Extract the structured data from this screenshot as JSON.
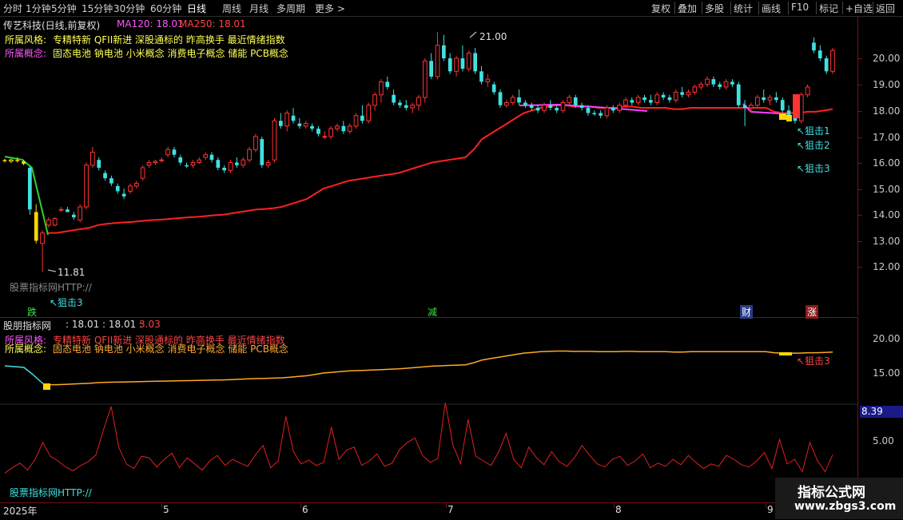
{
  "toolbar": {
    "left": [
      "分时",
      "1分钟",
      "5分钟",
      "15分钟",
      "30分钟",
      "60分钟",
      "日线",
      "周线",
      "月线",
      "多周期",
      "更多 >"
    ],
    "active_index": 6,
    "right": [
      "复权",
      "叠加",
      "多股",
      "统计",
      "画线",
      "F10",
      "标记",
      "+自选",
      "返回"
    ]
  },
  "main": {
    "title": "传艺科技(日线,前复权)",
    "ma120_label": "MA120: 18.01",
    "ma250_label": "MA250: 18.01",
    "style_label": "所属风格:",
    "style_text": "专精特新 QFII新进 深股通标的 昨高换手 最近情绪指数",
    "concept_label": "所属概念:",
    "concept_text": "固态电池 钠电池 小米概念 消费电子概念 储能 PCB概念",
    "high_label": "21.00",
    "low_label": "11.81",
    "watermark": "股票指标网HTTP://",
    "snipe1": "↖狙击1",
    "snipe2": "↖狙击2",
    "snipe3": "↖狙击3",
    "snipe_left": "↖狙击3",
    "marker_die": "跌",
    "marker_jian": "减",
    "marker_cai": "财",
    "marker_zhang": "涨",
    "y_ticks": [
      "20.00",
      "19.00",
      "18.00",
      "17.00",
      "16.00",
      "15.00",
      "14.00",
      "13.00",
      "12.00"
    ]
  },
  "sub": {
    "title": "股朋指标网",
    "values": ": 18.01 : 18.01 :",
    "value3": "3.03",
    "style_label": "所属风格:",
    "style_text": "专精特新 QFII新进 深股通标的 昨高换手 最近情绪指数",
    "concept_label": "所属概念:",
    "concept_text": "固态电池 钠电池 小米概念 消费电子概念 储能 PCB概念",
    "snipe": "↖狙击3",
    "watermark": "股票指标网HTTP://",
    "y_ticks_upper": [
      "20.00",
      "15.00"
    ],
    "y_ticks_lower": [
      "5.00"
    ],
    "current_value": "8.39"
  },
  "time_axis": {
    "labels": [
      "2025年",
      "5",
      "6",
      "7",
      "8",
      "9"
    ]
  },
  "logo": {
    "line1": "指标公式网",
    "line2": "www.zbgs3.com"
  },
  "colors": {
    "up": "#ff3333",
    "down": "#40e0e0",
    "ma": "#ff2020",
    "highlight": "#ffd700",
    "magenta": "#ff40ff"
  },
  "chart_data": {
    "type": "candlestick",
    "ylim": [
      11.5,
      21.5
    ],
    "candles": [
      [
        16.1,
        16.15,
        16.0,
        16.05
      ],
      [
        16.05,
        16.15,
        15.98,
        16.1
      ],
      [
        16.1,
        16.2,
        16.0,
        16.05
      ],
      [
        16.05,
        16.1,
        15.9,
        15.95
      ],
      [
        15.8,
        15.9,
        14.0,
        14.2
      ],
      [
        14.1,
        14.4,
        12.9,
        13.0
      ],
      [
        12.9,
        13.4,
        11.81,
        13.3
      ],
      [
        13.6,
        13.9,
        13.5,
        13.8
      ],
      [
        13.6,
        13.9,
        13.55,
        13.85
      ],
      [
        14.2,
        14.3,
        14.1,
        14.2
      ],
      [
        14.2,
        14.3,
        14.1,
        14.1
      ],
      [
        14.0,
        14.1,
        13.8,
        13.9
      ],
      [
        13.8,
        14.4,
        13.7,
        14.3
      ],
      [
        14.3,
        16.0,
        14.2,
        15.9
      ],
      [
        15.9,
        16.6,
        15.8,
        16.4
      ],
      [
        16.1,
        16.2,
        15.7,
        15.8
      ],
      [
        15.6,
        15.7,
        15.3,
        15.4
      ],
      [
        15.4,
        15.5,
        15.1,
        15.2
      ],
      [
        15.1,
        15.2,
        14.8,
        14.9
      ],
      [
        14.8,
        15.0,
        14.6,
        14.7
      ],
      [
        14.9,
        15.2,
        14.8,
        15.1
      ],
      [
        15.1,
        15.3,
        15.0,
        15.2
      ],
      [
        15.4,
        15.9,
        15.3,
        15.8
      ],
      [
        15.9,
        16.1,
        15.8,
        16.0
      ],
      [
        16.0,
        16.1,
        15.9,
        16.05
      ],
      [
        16.1,
        16.2,
        16.0,
        16.1
      ],
      [
        16.3,
        16.6,
        16.2,
        16.5
      ],
      [
        16.5,
        16.6,
        16.2,
        16.3
      ],
      [
        16.2,
        16.3,
        15.9,
        16.0
      ],
      [
        15.9,
        16.0,
        15.8,
        15.85
      ],
      [
        15.9,
        16.1,
        15.8,
        16.0
      ],
      [
        16.0,
        16.2,
        15.95,
        16.1
      ],
      [
        16.2,
        16.4,
        16.1,
        16.3
      ],
      [
        16.3,
        16.4,
        16.0,
        16.1
      ],
      [
        16.1,
        16.2,
        15.7,
        15.8
      ],
      [
        15.8,
        15.9,
        15.6,
        15.7
      ],
      [
        15.7,
        16.1,
        15.6,
        16.0
      ],
      [
        16.0,
        16.2,
        15.8,
        15.9
      ],
      [
        15.9,
        16.2,
        15.8,
        16.1
      ],
      [
        16.1,
        16.6,
        16.0,
        16.5
      ],
      [
        16.5,
        17.1,
        16.4,
        17.0
      ],
      [
        16.9,
        17.0,
        15.8,
        15.9
      ],
      [
        15.9,
        16.1,
        15.8,
        16.0
      ],
      [
        16.1,
        17.7,
        16.0,
        17.6
      ],
      [
        17.6,
        17.9,
        17.3,
        17.4
      ],
      [
        17.4,
        18.0,
        17.2,
        17.9
      ],
      [
        17.8,
        18.1,
        17.5,
        17.6
      ],
      [
        17.5,
        17.7,
        17.3,
        17.4
      ],
      [
        17.4,
        17.6,
        17.3,
        17.5
      ],
      [
        17.4,
        17.5,
        17.2,
        17.3
      ],
      [
        17.3,
        17.4,
        17.0,
        17.1
      ],
      [
        17.0,
        17.2,
        16.9,
        17.0
      ],
      [
        17.0,
        17.4,
        16.9,
        17.3
      ],
      [
        17.3,
        17.5,
        17.2,
        17.4
      ],
      [
        17.4,
        17.6,
        17.1,
        17.2
      ],
      [
        17.2,
        17.5,
        17.1,
        17.4
      ],
      [
        17.4,
        17.9,
        17.3,
        17.8
      ],
      [
        17.8,
        18.2,
        17.5,
        17.6
      ],
      [
        17.6,
        18.3,
        17.5,
        18.2
      ],
      [
        18.2,
        18.7,
        18.0,
        18.6
      ],
      [
        18.6,
        19.2,
        18.3,
        19.1
      ],
      [
        19.1,
        19.3,
        18.8,
        18.9
      ],
      [
        18.6,
        18.8,
        18.2,
        18.3
      ],
      [
        18.3,
        18.4,
        18.1,
        18.2
      ],
      [
        18.2,
        18.4,
        18.0,
        18.1
      ],
      [
        18.1,
        18.3,
        17.9,
        18.2
      ],
      [
        18.2,
        18.6,
        18.0,
        18.5
      ],
      [
        18.5,
        20.0,
        18.3,
        19.9
      ],
      [
        19.9,
        20.2,
        19.2,
        19.3
      ],
      [
        19.3,
        21.0,
        19.2,
        20.5
      ],
      [
        20.5,
        20.9,
        19.9,
        20.0
      ],
      [
        20.0,
        20.2,
        19.4,
        19.5
      ],
      [
        19.5,
        20.1,
        19.3,
        20.0
      ],
      [
        20.0,
        20.5,
        19.5,
        19.6
      ],
      [
        19.6,
        20.3,
        19.5,
        20.2
      ],
      [
        20.2,
        20.4,
        19.4,
        19.5
      ],
      [
        19.5,
        19.7,
        19.0,
        19.1
      ],
      [
        19.1,
        19.4,
        18.9,
        19.2
      ],
      [
        19.0,
        19.1,
        18.6,
        18.7
      ],
      [
        18.7,
        18.8,
        18.1,
        18.2
      ],
      [
        18.2,
        18.4,
        18.1,
        18.3
      ],
      [
        18.3,
        18.6,
        18.2,
        18.5
      ],
      [
        18.5,
        18.8,
        18.2,
        18.3
      ],
      [
        18.3,
        18.4,
        18.1,
        18.2
      ],
      [
        18.2,
        18.3,
        18.0,
        18.1
      ],
      [
        18.1,
        18.2,
        17.9,
        18.0
      ],
      [
        18.0,
        18.3,
        17.9,
        18.2
      ],
      [
        18.2,
        18.4,
        18.0,
        18.1
      ],
      [
        18.1,
        18.2,
        17.9,
        18.0
      ],
      [
        18.0,
        18.4,
        17.9,
        18.3
      ],
      [
        18.3,
        18.6,
        18.2,
        18.5
      ],
      [
        18.5,
        18.6,
        18.1,
        18.2
      ],
      [
        18.2,
        18.3,
        18.0,
        18.1
      ],
      [
        18.1,
        18.2,
        17.8,
        17.9
      ],
      [
        17.9,
        18.0,
        17.8,
        17.85
      ],
      [
        17.9,
        18.0,
        17.7,
        17.8
      ],
      [
        17.8,
        18.2,
        17.7,
        18.1
      ],
      [
        18.1,
        18.2,
        17.9,
        18.0
      ],
      [
        18.0,
        18.3,
        17.9,
        18.2
      ],
      [
        18.2,
        18.5,
        18.1,
        18.4
      ],
      [
        18.4,
        18.5,
        18.2,
        18.3
      ],
      [
        18.3,
        18.6,
        18.2,
        18.5
      ],
      [
        18.5,
        18.6,
        18.3,
        18.4
      ],
      [
        18.4,
        18.6,
        18.2,
        18.3
      ],
      [
        18.3,
        18.7,
        18.2,
        18.6
      ],
      [
        18.6,
        18.7,
        18.4,
        18.5
      ],
      [
        18.5,
        18.6,
        18.3,
        18.4
      ],
      [
        18.4,
        18.8,
        18.3,
        18.7
      ],
      [
        18.7,
        18.9,
        18.5,
        18.6
      ],
      [
        18.6,
        18.8,
        18.5,
        18.7
      ],
      [
        18.7,
        19.0,
        18.6,
        18.9
      ],
      [
        18.9,
        19.1,
        18.8,
        19.0
      ],
      [
        19.0,
        19.3,
        18.9,
        19.2
      ],
      [
        19.2,
        19.3,
        18.9,
        19.0
      ],
      [
        19.0,
        19.1,
        18.8,
        18.9
      ],
      [
        18.9,
        19.2,
        18.8,
        19.1
      ],
      [
        19.1,
        19.2,
        18.9,
        19.0
      ],
      [
        19.0,
        19.1,
        18.1,
        18.2
      ],
      [
        18.2,
        18.4,
        17.4,
        18.1
      ],
      [
        18.1,
        18.3,
        17.9,
        18.2
      ],
      [
        18.2,
        18.6,
        18.1,
        18.5
      ],
      [
        18.5,
        18.8,
        18.3,
        18.4
      ],
      [
        18.4,
        18.6,
        18.2,
        18.5
      ],
      [
        18.5,
        18.7,
        18.3,
        18.4
      ],
      [
        18.4,
        18.5,
        17.9,
        18.0
      ],
      [
        18.0,
        18.2,
        17.6,
        17.7
      ],
      [
        17.7,
        17.9,
        17.5,
        17.6
      ],
      [
        17.6,
        18.7,
        17.5,
        18.6
      ],
      [
        18.6,
        19.0,
        18.5,
        18.9
      ],
      [
        20.6,
        20.8,
        20.2,
        20.3
      ],
      [
        20.3,
        20.5,
        19.9,
        20.0
      ],
      [
        20.0,
        20.1,
        19.4,
        19.5
      ],
      [
        19.5,
        20.4,
        19.4,
        20.3
      ]
    ],
    "ma": [
      13.3,
      13.3,
      13.35,
      13.4,
      13.45,
      13.5,
      13.6,
      13.65,
      13.68,
      13.7,
      13.72,
      13.75,
      13.78,
      13.8,
      13.82,
      13.85,
      13.88,
      13.9,
      13.92,
      13.95,
      13.98,
      14.0,
      14.05,
      14.1,
      14.15,
      14.2,
      14.22,
      14.25,
      14.3,
      14.4,
      14.5,
      14.6,
      14.8,
      15.0,
      15.1,
      15.2,
      15.3,
      15.35,
      15.4,
      15.45,
      15.5,
      15.55,
      15.6,
      15.7,
      15.8,
      15.9,
      16.0,
      16.05,
      16.1,
      16.15,
      16.2,
      16.5,
      16.9,
      17.1,
      17.3,
      17.5,
      17.7,
      17.9,
      18.0,
      18.1,
      18.15,
      18.2,
      18.2,
      18.15,
      18.15,
      18.15,
      18.1,
      18.1,
      18.1,
      18.15,
      18.15,
      18.1,
      18.1,
      18.1,
      18.1,
      18.05,
      18.05,
      18.1,
      18.1,
      18.1,
      18.1,
      18.1,
      18.1,
      18.1,
      18.1,
      18.1,
      18.1,
      17.95,
      17.9,
      17.9,
      17.9,
      17.95,
      17.95,
      18.0,
      18.05
    ],
    "volume": [
      0.8,
      1.5,
      2.1,
      1.2,
      2.6,
      4.8,
      3.0,
      2.4,
      1.6,
      1.1,
      1.8,
      2.3,
      3.2,
      6.5,
      9.5,
      4.2,
      2.0,
      1.4,
      3.0,
      2.8,
      1.6,
      2.6,
      3.4,
      1.5,
      2.8,
      2.0,
      1.2,
      2.4,
      3.1,
      1.8,
      2.6,
      2.1,
      1.7,
      3.2,
      4.4,
      1.5,
      2.4,
      8.2,
      3.6,
      2.0,
      2.5,
      1.8,
      2.2,
      6.8,
      2.6,
      3.8,
      4.2,
      1.8,
      2.4,
      3.3,
      1.7,
      2.1,
      3.9,
      4.8,
      5.4,
      3.1,
      2.2,
      2.7,
      10.0,
      4.5,
      2.0,
      7.8,
      3.0,
      2.4,
      1.8,
      3.5,
      6.0,
      2.6,
      1.5,
      4.2,
      2.8,
      1.9,
      3.6,
      2.3,
      1.7,
      2.8,
      4.4,
      3.1,
      2.0,
      1.6,
      2.6,
      3.0,
      1.8,
      2.4,
      3.3,
      1.5,
      2.1,
      1.7,
      2.6,
      1.9,
      3.1,
      2.2,
      1.4,
      2.0,
      1.7,
      3.1,
      2.6,
      1.9,
      1.6,
      2.4,
      3.5,
      1.4,
      5.2,
      2.0,
      2.6,
      1.0,
      4.8,
      2.4,
      1.0,
      3.2
    ]
  }
}
